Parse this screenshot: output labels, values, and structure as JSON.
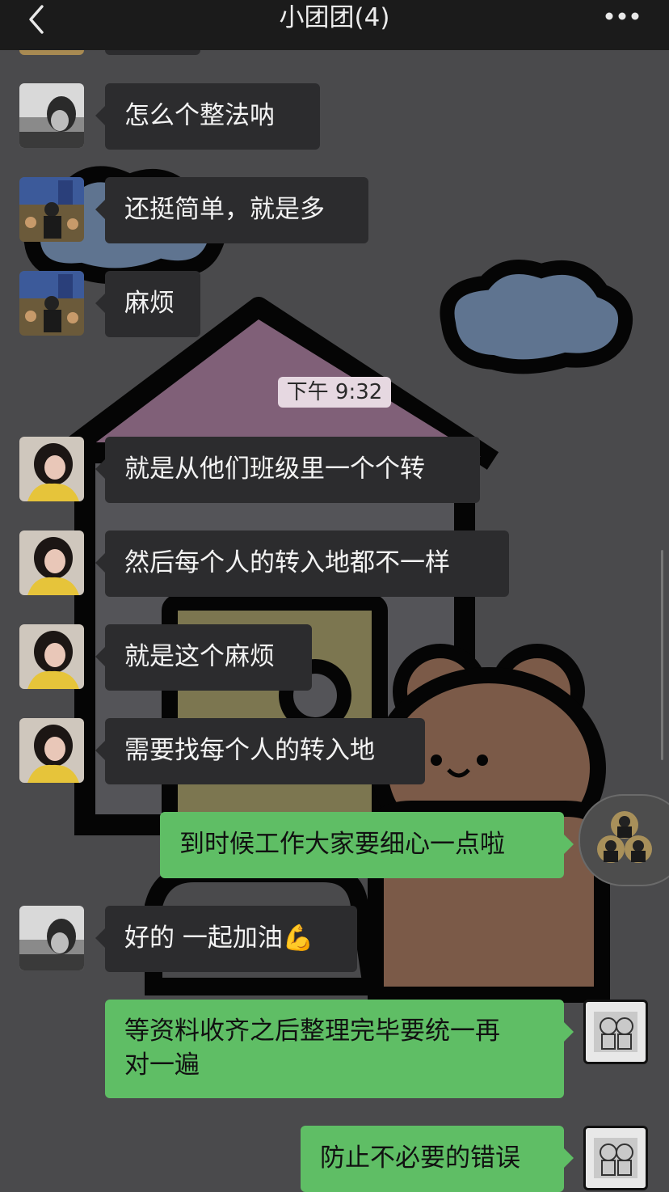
{
  "header": {
    "title": "小团团(4)",
    "back_icon": "back-chevron-icon",
    "more_icon": "more-dots-icon"
  },
  "timestamp": "下午 9:32",
  "messages": [
    {
      "text": "怎么个整法呐",
      "direction": "incoming",
      "avatar": "avatar-bw-portrait"
    },
    {
      "text": "还挺简单，就是多",
      "direction": "incoming",
      "avatar": "avatar-crowd-photo"
    },
    {
      "text": "麻烦",
      "direction": "incoming",
      "avatar": "avatar-crowd-photo"
    },
    {
      "text": "就是从他们班级里一个个转",
      "direction": "incoming",
      "avatar": "avatar-girl-yellow"
    },
    {
      "text": "然后每个人的转入地都不一样",
      "direction": "incoming",
      "avatar": "avatar-girl-yellow"
    },
    {
      "text": "就是这个麻烦",
      "direction": "incoming",
      "avatar": "avatar-girl-yellow"
    },
    {
      "text": "需要找每个人的转入地",
      "direction": "incoming",
      "avatar": "avatar-girl-yellow"
    },
    {
      "text": "到时候工作大家要细心一点啦",
      "direction": "outgoing",
      "avatar": ""
    },
    {
      "text": "好的 一起加油💪",
      "direction": "incoming",
      "avatar": "avatar-bw-portrait"
    },
    {
      "text": "等资料收齐之后整理完毕要统一再对一遍",
      "line1": "等资料收齐之后整理完毕要统一再",
      "line2": "对一遍",
      "direction": "outgoing",
      "avatar": "avatar-bears-sketch"
    },
    {
      "text": "防止不必要的错误",
      "direction": "outgoing",
      "avatar": "avatar-bears-sketch"
    }
  ],
  "colors": {
    "header_bg": "#1b1b1b",
    "incoming_bubble": "#2c2c2e",
    "outgoing_bubble": "#5fbe65",
    "timestamp_bg": "#e6d8e1",
    "wallpaper": "#4a4a4c"
  }
}
